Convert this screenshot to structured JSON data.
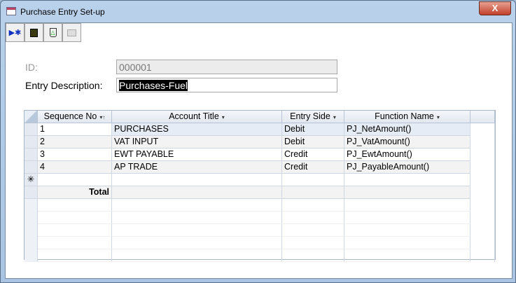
{
  "window": {
    "title": "Purchase Entry Set-up",
    "close": "X"
  },
  "toolbar": [
    {
      "icon": "new-record-icon"
    },
    {
      "icon": "save-icon"
    },
    {
      "icon": "delete-icon"
    },
    {
      "icon": "print-icon"
    }
  ],
  "form": {
    "id_label": "ID:",
    "id_value": "000001",
    "desc_label": "Entry Description:",
    "desc_value": "Purchases-Fuel"
  },
  "grid": {
    "columns": [
      "Sequence No",
      "Account Title",
      "Entry Side",
      "Function Name"
    ],
    "rows": [
      {
        "seq": "1",
        "account": "PURCHASES",
        "side": "Debit",
        "func": "PJ_NetAmount()"
      },
      {
        "seq": "2",
        "account": "VAT INPUT",
        "side": "Debit",
        "func": "PJ_VatAmount()"
      },
      {
        "seq": "3",
        "account": "EWT PAYABLE",
        "side": "Credit",
        "func": "PJ_EwtAmount()"
      },
      {
        "seq": "4",
        "account": "AP TRADE",
        "side": "Credit",
        "func": "PJ_PayableAmount()"
      }
    ],
    "new_row_marker": "✳",
    "total_label": "Total"
  }
}
